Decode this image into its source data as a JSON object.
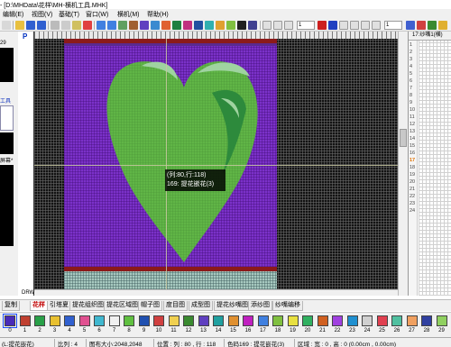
{
  "window": {
    "title": "- [D:\\MHData\\花样\\MH-横机工具.MHK]"
  },
  "menubar": {
    "items": [
      {
        "label": "编辑(E)"
      },
      {
        "label": "视图(V)"
      },
      {
        "label": "基础(T)"
      },
      {
        "label": "窗口(W)"
      },
      {
        "label": "横机(M)"
      },
      {
        "label": "帮助(H)"
      }
    ]
  },
  "toolbar": {
    "numeric_value": "1",
    "zoom_value": "1"
  },
  "left_panel": {
    "num_label": "29",
    "label_1": "工具",
    "label_2": "屏幕*"
  },
  "panel_labels": {
    "p_label": "P",
    "drw_label": "DRW"
  },
  "tooltip": {
    "line1": "(列:80,行:118)",
    "line2": "169: 提花嵌花(3)"
  },
  "right_panel": {
    "header": "17:纱嘴1(横)",
    "row_numbers": [
      "1",
      "2",
      "3",
      "4",
      "5",
      "6",
      "7",
      "8",
      "9",
      "10",
      "11",
      "12",
      "13",
      "14",
      "15",
      "16",
      "17",
      "18",
      "19",
      "20",
      "21",
      "22",
      "23",
      "24"
    ],
    "highlight_row": "17"
  },
  "tabs": [
    {
      "label": "复制",
      "active": false
    },
    {
      "label": "花样",
      "active": true
    },
    {
      "label": "引塔夏",
      "active": false
    },
    {
      "label": "提花组织图",
      "active": false
    },
    {
      "label": "提花区域图",
      "active": false
    },
    {
      "label": "帽子图",
      "active": false
    },
    {
      "label": "度目图",
      "active": false
    },
    {
      "label": "成型图",
      "active": false
    },
    {
      "label": "提花纱嘴图",
      "active": false
    },
    {
      "label": "添纱图",
      "active": false
    },
    {
      "label": "纱嘴编移",
      "active": false
    }
  ],
  "palette": {
    "selected_index": 0,
    "swatches": [
      {
        "number": "0",
        "color": "#4a2bb8"
      },
      {
        "number": "1",
        "color": "#c04030"
      },
      {
        "number": "2",
        "color": "#28a048"
      },
      {
        "number": "3",
        "color": "#e8c030"
      },
      {
        "number": "4",
        "color": "#3060d0"
      },
      {
        "number": "5",
        "color": "#e05090"
      },
      {
        "number": "6",
        "color": "#40b8d0"
      },
      {
        "number": "7",
        "color": "#f0f0f0"
      },
      {
        "number": "8",
        "color": "#60c040"
      },
      {
        "number": "9",
        "color": "#2050b0"
      },
      {
        "number": "10",
        "color": "#d04040"
      },
      {
        "number": "11",
        "color": "#f0d050"
      },
      {
        "number": "12",
        "color": "#3a8a30"
      },
      {
        "number": "13",
        "color": "#6040c0"
      },
      {
        "number": "14",
        "color": "#20a0a0"
      },
      {
        "number": "15",
        "color": "#e09030"
      },
      {
        "number": "16",
        "color": "#c020c0"
      },
      {
        "number": "17",
        "color": "#4080e0"
      },
      {
        "number": "18",
        "color": "#80c040"
      },
      {
        "number": "19",
        "color": "#e8e040"
      },
      {
        "number": "20",
        "color": "#30b060"
      },
      {
        "number": "21",
        "color": "#d06020"
      },
      {
        "number": "22",
        "color": "#a040e0"
      },
      {
        "number": "23",
        "color": "#2090d0"
      },
      {
        "number": "24",
        "color": "#d0d0d0"
      },
      {
        "number": "25",
        "color": "#e04050"
      },
      {
        "number": "26",
        "color": "#50c0a0"
      },
      {
        "number": "27",
        "color": "#f0a060"
      },
      {
        "number": "28",
        "color": "#3040a0"
      },
      {
        "number": "29",
        "color": "#90d060"
      }
    ]
  },
  "statusbar": {
    "mode": "(L:提花嵌花)",
    "ratio": "比列 : 4",
    "canvas_size": "图布大小:2048,2048",
    "position": "位置 : 列 : 80 , 行 : 118",
    "color_code": "色码169 : 提花嵌花(3)",
    "region": "区域 : 宽 : 0 , 高 : 0 (0.00cm , 0.00cm)"
  },
  "colors": {
    "background_purple": "#7b31c9",
    "heart_green": "#60b546",
    "heart_light": "#9fd3a0",
    "heart_dark": "#2d8a3c",
    "top_band": "#8b1a1a",
    "bottom_band": "#a7c9c0"
  }
}
